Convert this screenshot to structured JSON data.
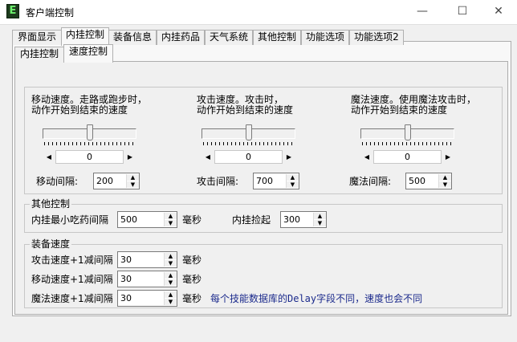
{
  "colors": {
    "note_text": "#1b2a8c",
    "app_icon": "#1d3b1d"
  },
  "window": {
    "title": "客户端控制",
    "icon": "app-logo-icon"
  },
  "main_tabs": [
    {
      "label": "界面显示"
    },
    {
      "label": "内挂控制",
      "active": true
    },
    {
      "label": "装备信息"
    },
    {
      "label": "内挂药品"
    },
    {
      "label": "天气系统"
    },
    {
      "label": "其他控制"
    },
    {
      "label": "功能选项"
    },
    {
      "label": "功能选项2"
    }
  ],
  "sub_tabs": [
    {
      "label": "内挂控制"
    },
    {
      "label": "速度控制",
      "active": true
    }
  ],
  "speed": {
    "move": {
      "desc1": "移动速度。走路或跑步时，",
      "desc2": "动作开始到结束的速度",
      "slider_level": 0.5,
      "scroll_value": "0",
      "interval_label": "移动间隔:",
      "interval_value": "200"
    },
    "attack": {
      "desc1": "攻击速度。攻击时，",
      "desc2": "动作开始到结束的速度",
      "slider_level": 0.5,
      "scroll_value": "0",
      "interval_label": "攻击间隔:",
      "interval_value": "700"
    },
    "magic": {
      "desc1": "魔法速度。使用魔法攻击时，",
      "desc2": "动作开始到结束的速度",
      "slider_level": 0.5,
      "scroll_value": "0",
      "interval_label": "魔法间隔:",
      "interval_value": "500"
    }
  },
  "other": {
    "title": "其他控制",
    "eat_label": "内挂最小吃药间隔",
    "eat_value": "500",
    "eat_unit": "毫秒",
    "pickup_label": "内挂捡起",
    "pickup_value": "300"
  },
  "equip": {
    "title": "装备速度",
    "rows": [
      {
        "label": "攻击速度+1减间隔",
        "value": "30",
        "unit": "毫秒"
      },
      {
        "label": "移动速度+1减间隔",
        "value": "30",
        "unit": "毫秒"
      },
      {
        "label": "魔法速度+1减间隔",
        "value": "30",
        "unit": "毫秒"
      }
    ],
    "note": "每个技能数据库的Delay字段不同，速度也会不同"
  }
}
